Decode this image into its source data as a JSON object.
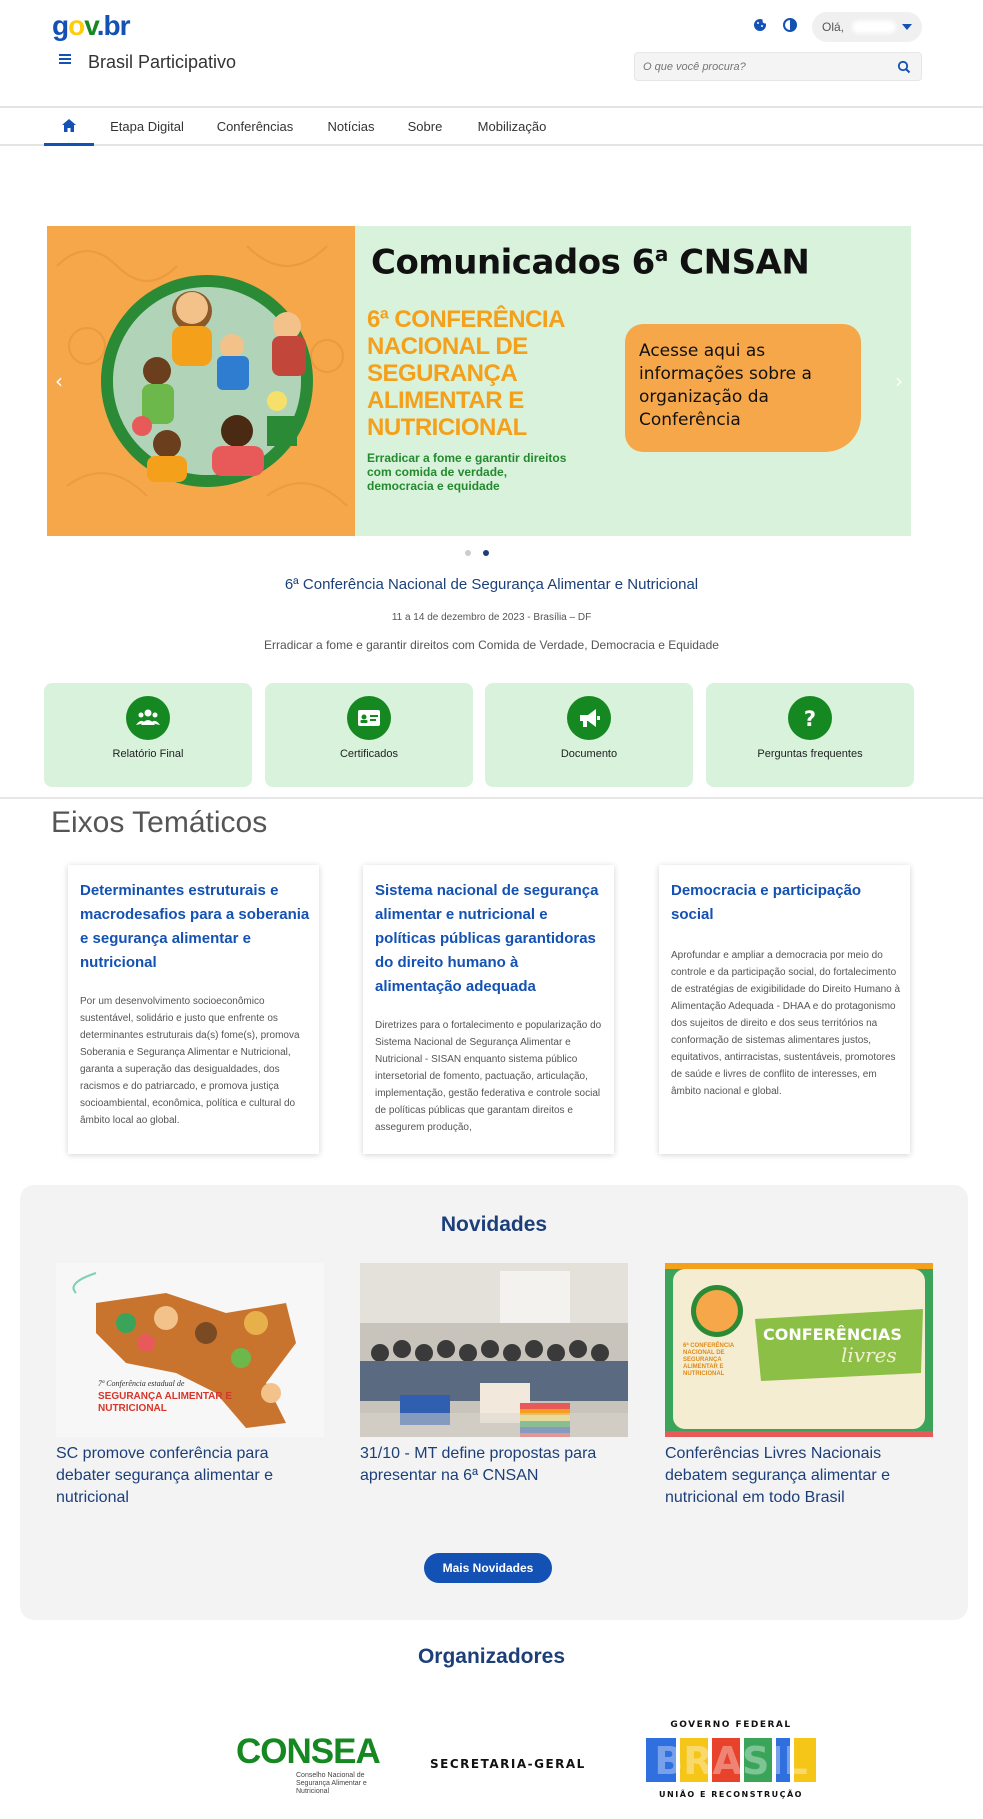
{
  "header": {
    "logo": {
      "g": "g",
      "o": "o",
      "v": "v",
      "dot": ".",
      "b": "b",
      "r": "r"
    },
    "site_title": "Brasil Participativo",
    "user_greeting": "Olá,",
    "search_placeholder": "O que você procura?"
  },
  "nav": {
    "items": [
      {
        "label": "Etapa Digital"
      },
      {
        "label": "Conferências"
      },
      {
        "label": "Notícias"
      },
      {
        "label": "Sobre"
      },
      {
        "label": "Mobilização"
      }
    ]
  },
  "carousel": {
    "slide_title": "Comunicados 6",
    "slide_title_sup": "a",
    "slide_title_end": " CNSAN",
    "conf_title": "6ª Conferência Nacional de Segurança Alimentar e Nutricional",
    "conf_sub": "Erradicar a fome e garantir direitos com comida de verdade, democracia e equidade",
    "cta": "Acesse aqui as informações sobre a organização da Conferência",
    "prev": "‹",
    "next": "›",
    "active_dot": 2,
    "dot_count": 2
  },
  "event": {
    "title": "6ª Conferência Nacional de Segurança Alimentar e Nutricional",
    "date": "11 a 14 de dezembro de 2023 - Brasília – DF",
    "motto": "Erradicar a fome e garantir direitos com Comida de Verdade, Democracia e Equidade"
  },
  "quick_links": [
    {
      "label": "Relatório Final",
      "icon": "users-icon"
    },
    {
      "label": "Certificados",
      "icon": "id-card-icon"
    },
    {
      "label": "Documento",
      "icon": "megaphone-icon"
    },
    {
      "label": "Perguntas frequentes",
      "icon": "question-icon"
    }
  ],
  "eixos": {
    "title": "Eixos Temáticos",
    "cards": [
      {
        "title": "Determinantes estruturais e macrodesafios para a soberania e segurança alimentar e nutricional",
        "text": "Por um desenvolvimento socioeconômico sustentável, solidário e justo que enfrente os determinantes estruturais da(s) fome(s), promova Soberania e Segurança Alimentar e Nutricional, garanta a superação das desigualdades, dos racismos e do patriarcado, e promova justiça socioambiental, econômica, política e cultural do âmbito local ao global."
      },
      {
        "title": "Sistema nacional de segurança alimentar e nutricional e políticas públicas garantidoras do direito humano à alimentação adequada",
        "text": "Diretrizes para o fortalecimento e popularização do Sistema Nacional de Segurança Alimentar e Nutricional - SISAN enquanto sistema público intersetorial de fomento, pactuação, articulação, implementação, gestão federativa e controle social de políticas públicas que garantam direitos e assegurem produção,"
      },
      {
        "title": "Democracia e participação social",
        "text": "Aprofundar e ampliar a democracia por meio do controle e da participação social, do fortalecimento de estratégias de exigibilidade do Direito Humano à Alimentação Adequada - DHAA e do protagonismo dos sujeitos de direito e dos seus territórios na conformação de sistemas alimentares justos, equitativos, antirracistas, sustentáveis, promotores de saúde e livres de conflito de interesses, em âmbito nacional e global."
      }
    ]
  },
  "news": {
    "title": "Novidades",
    "items": [
      {
        "title": "SC promove conferência para debater segurança alimentar e nutricional",
        "img_caption_small": "7ª Conferência estadual de",
        "img_caption_big": "SEGURANÇA ALIMENTAR E NUTRICIONAL"
      },
      {
        "title": "31/10 - MT define propostas para apresentar na 6ª CNSAN"
      },
      {
        "title": "Conferências Livres Nacionais debatem segurança alimentar e nutricional em todo Brasil",
        "img_badge_1": "CONFERÊNCIAS",
        "img_badge_2": "livres",
        "img_small": "6ª CONFERÊNCIA NACIONAL DE SEGURANÇA ALIMENTAR E NUTRICIONAL"
      }
    ],
    "more_label": "Mais Novidades"
  },
  "organizers": {
    "title": "Organizadores",
    "consea_name": "CONSEA",
    "consea_sub": "Conselho Nacional de Segurança Alimentar e Nutricional",
    "secretaria": "SECRETARIA-GERAL",
    "gov_top": "GOVERNO FEDERAL",
    "gov_word": "BRASIL",
    "gov_bottom": "UNIÃO E RECONSTRUÇÃO"
  },
  "colors": {
    "primary_blue": "#1351b4",
    "green": "#168821",
    "light_green": "#d9f2dc",
    "orange": "#f5a74a"
  }
}
